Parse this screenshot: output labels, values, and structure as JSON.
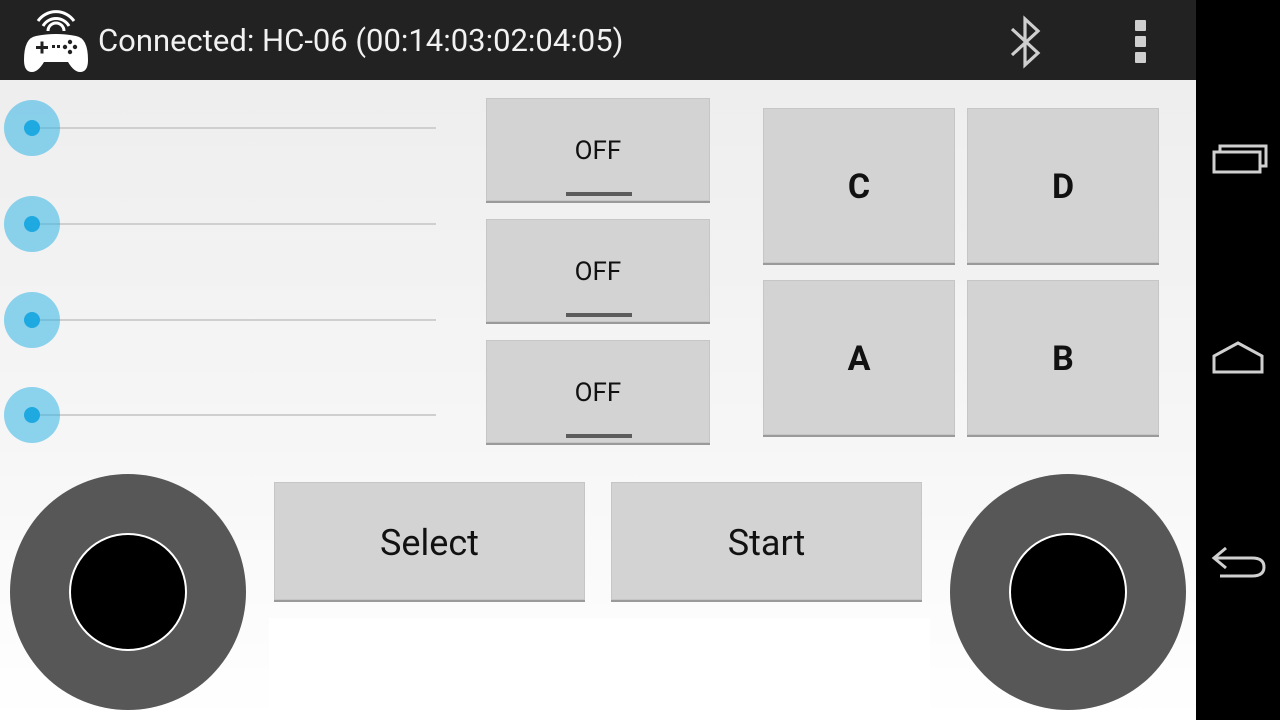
{
  "action_bar": {
    "title": "Connected: HC-06 (00:14:03:02:04:05)",
    "app_icon": "gamepad-wifi-icon",
    "bluetooth_icon": "bluetooth-icon",
    "overflow_icon": "overflow-menu-icon"
  },
  "sliders": [
    {
      "name": "slider-1",
      "value": 0
    },
    {
      "name": "slider-2",
      "value": 0
    },
    {
      "name": "slider-3",
      "value": 0
    },
    {
      "name": "slider-4",
      "value": 0
    }
  ],
  "toggles": [
    {
      "label": "OFF"
    },
    {
      "label": "OFF"
    },
    {
      "label": "OFF"
    }
  ],
  "buttons": {
    "c": "C",
    "d": "D",
    "a": "A",
    "b": "B",
    "select": "Select",
    "start": "Start"
  },
  "nav": {
    "recents_icon": "recents-icon",
    "home_icon": "home-icon",
    "back_icon": "back-icon"
  },
  "colors": {
    "action_bar": "#222222",
    "accent": "#33b5e5",
    "joystick_ring": "#575757"
  }
}
